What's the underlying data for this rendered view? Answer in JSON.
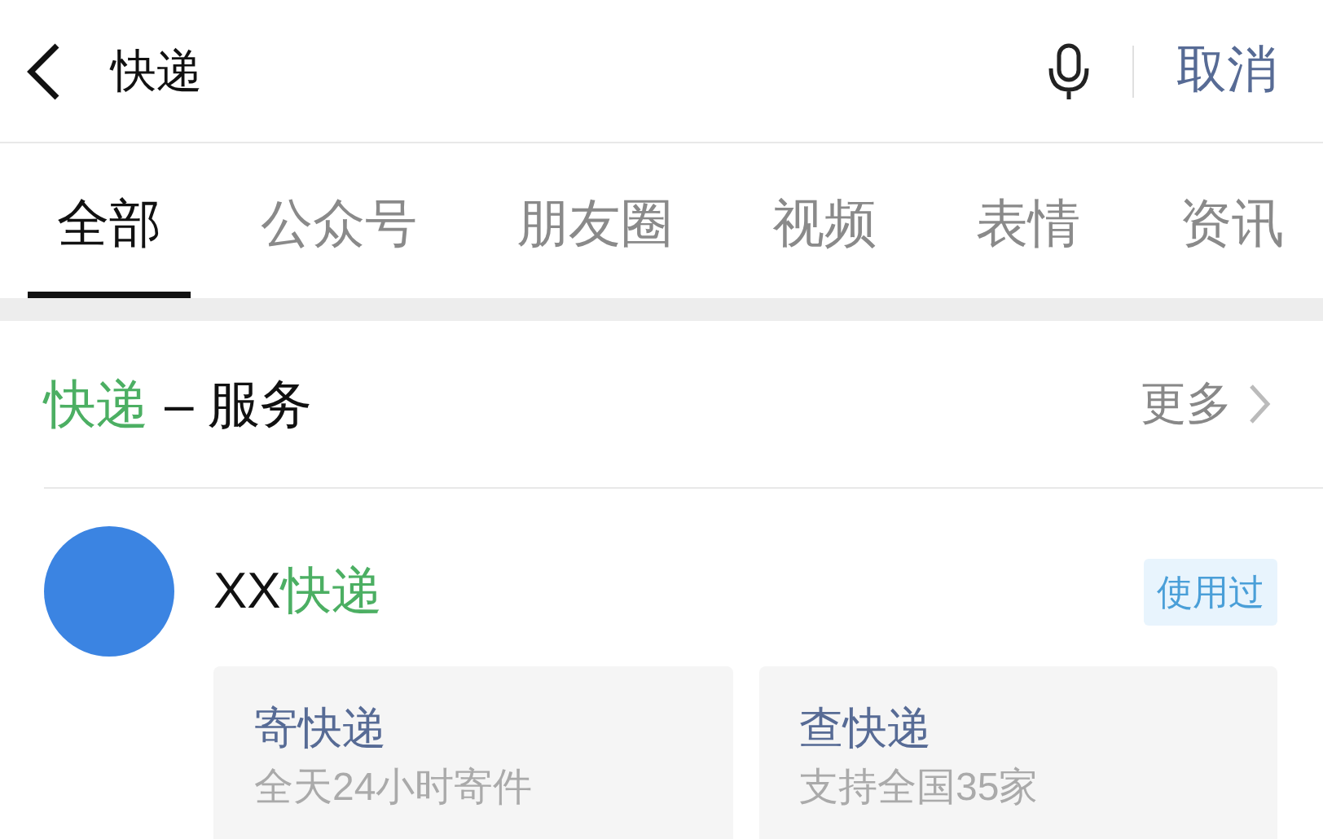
{
  "search_bar": {
    "value": "快递",
    "cancel": "取消"
  },
  "tabs": [
    {
      "label": "全部",
      "selected": true
    },
    {
      "label": "公众号",
      "selected": false
    },
    {
      "label": "朋友圈",
      "selected": false
    },
    {
      "label": "视频",
      "selected": false
    },
    {
      "label": "表情",
      "selected": false
    },
    {
      "label": "资讯",
      "selected": false
    }
  ],
  "section": {
    "title": [
      {
        "text": "快递",
        "highlight": true
      },
      {
        "text": "– 服务",
        "highlight": false
      }
    ],
    "more": "更多"
  },
  "service": {
    "name": [
      {
        "text": "XX",
        "highlight": false
      },
      {
        "text": "快递",
        "highlight": true
      }
    ],
    "badge": "使用过",
    "actions": [
      {
        "title": "寄快递",
        "subtitle": "全天24小时寄件"
      },
      {
        "title": "查快递",
        "subtitle": "支持全国35家"
      }
    ]
  }
}
